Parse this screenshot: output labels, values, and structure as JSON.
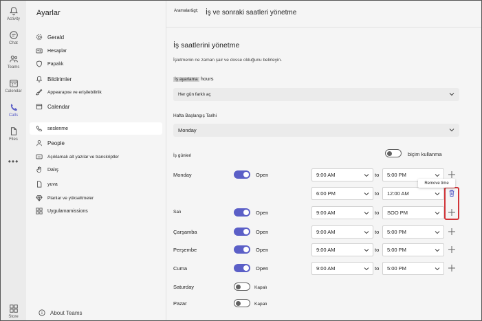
{
  "rail": {
    "items": [
      {
        "label": "Activity",
        "icon": "bell-icon"
      },
      {
        "label": "Chat",
        "icon": "chat-icon"
      },
      {
        "label": "Teams",
        "icon": "teams-icon"
      },
      {
        "label": "Calendar",
        "icon": "calendar-icon"
      },
      {
        "label": "Calls",
        "icon": "phone-icon"
      },
      {
        "label": "Files",
        "icon": "file-icon"
      }
    ],
    "more": "•••",
    "store": "Store"
  },
  "sidebar": {
    "title": "Ayarlar",
    "items": [
      {
        "label": "Gerald",
        "icon": "gear-icon"
      },
      {
        "label": "Hesaplar",
        "icon": "id-card-icon"
      },
      {
        "label": "Papalık",
        "icon": "shield-icon"
      },
      {
        "label": "Bildirimler",
        "icon": "bell-icon"
      },
      {
        "label": "Appearaрxe ve erişilebilirlik",
        "icon": "brush-icon"
      },
      {
        "label": "Calendar",
        "icon": "calendar-icon"
      },
      {
        "label": "seslenme",
        "icon": "phone-icon"
      },
      {
        "label": "People",
        "icon": "person-icon"
      },
      {
        "label": "Açıklamalı alt yazılar ve transkriptler",
        "icon": "captions-icon"
      },
      {
        "label": "Dalış",
        "icon": "hand-icon"
      },
      {
        "label": "yuva",
        "icon": "file-icon"
      },
      {
        "label": "Planlar ve yükseltmeler",
        "icon": "diamond-icon"
      },
      {
        "label": "Uygulamamissions",
        "icon": "apps-icon"
      }
    ],
    "about": "About Teams"
  },
  "header": {
    "breadcrumb": "Aramalar&gt;",
    "title": "İş ve sonraki saatleri yönetme"
  },
  "content": {
    "heading": "İş saatlerini yönetme",
    "description": "İşletmenin ne zaman şair ve dosse olduğunu belirleyin.",
    "work_hours_label_a": "İş ayarlama",
    "work_hours_label_b": "hours",
    "work_hours_value": "Her gün farklı aç",
    "week_start_label": "Hafta Başlangıç Tarihi",
    "week_start_value": "Monday",
    "workdays_label": "İş günleri",
    "format_label": "biçim kullanma",
    "to_label": "to",
    "remove_tooltip": "Remove time",
    "days": [
      {
        "name": "Monday",
        "state": "Open",
        "from": "9:00 AM",
        "to": "5:00 PM"
      },
      {
        "name": "",
        "state": "",
        "from": "6:00 PM",
        "to": "12:00 AM"
      },
      {
        "name": "Salı",
        "state": "Open",
        "from": "9:00 AM",
        "to": "SOO PM"
      },
      {
        "name": "Çarşamba",
        "state": "Open",
        "from": "9:00 AM",
        "to": "5:00 PM"
      },
      {
        "name": "Perşembe",
        "state": "Open",
        "from": "9:00 AM",
        "to": "5:00 PM"
      },
      {
        "name": "Cuma",
        "state": "Open",
        "from": "9:00 AM",
        "to": "5:00 PM"
      },
      {
        "name": "Saturday",
        "state": "Kapalı"
      },
      {
        "name": "Pazar",
        "state": "Kapalı"
      }
    ]
  },
  "colors": {
    "accent": "#5b5fc7",
    "highlight": "#d13438"
  }
}
